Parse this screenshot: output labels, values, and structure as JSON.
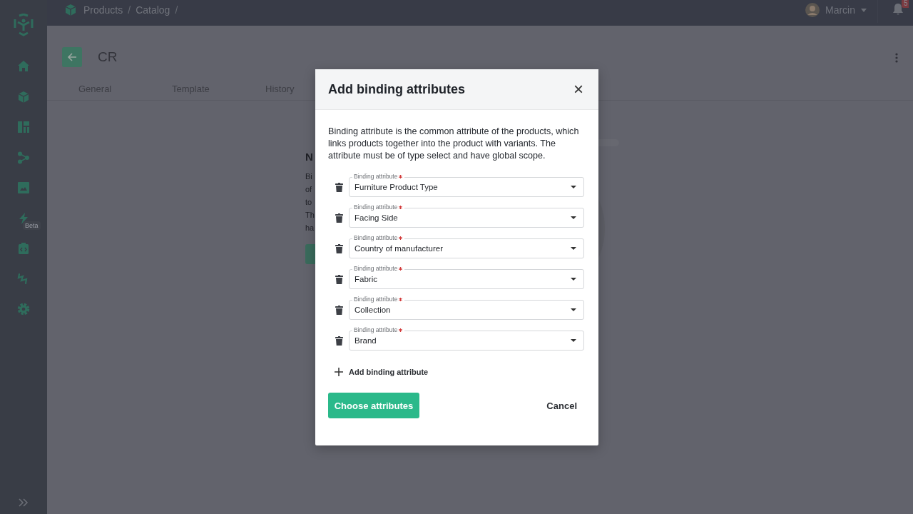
{
  "topbar": {
    "breadcrumbs": [
      "Products",
      "/",
      "Catalog",
      "/"
    ],
    "user": "Marcin",
    "notification_count": "5"
  },
  "sidebar": {
    "badge": "Beta"
  },
  "page": {
    "title": "CR",
    "tabs": [
      {
        "label": "General",
        "selected": false
      },
      {
        "label": "Template",
        "selected": false
      },
      {
        "label": "History",
        "selected": false
      }
    ]
  },
  "empty_state": {
    "heading": "N",
    "lines": [
      "Bi",
      "of",
      "to",
      "Th",
      "ha"
    ]
  },
  "dialog": {
    "title": "Add binding attributes",
    "close": "×",
    "description": "Binding attribute is the common attribute of the products, which links products together into the product with variants. The attribute must be of type select and have global scope.",
    "fields": [
      {
        "label": "Binding attribute",
        "required": true,
        "value": "Furniture Product Type"
      },
      {
        "label": "Binding attribute",
        "required": true,
        "value": "Facing Side"
      },
      {
        "label": "Binding attribute",
        "required": true,
        "value": "Country of manufacturer"
      },
      {
        "label": "Binding attribute",
        "required": true,
        "value": "Fabric"
      },
      {
        "label": "Binding attribute",
        "required": true,
        "value": "Collection"
      },
      {
        "label": "Binding attribute",
        "required": true,
        "value": "Brand"
      }
    ],
    "add_label": "Add binding attribute",
    "primary_button": "Choose attributes",
    "cancel_button": "Cancel"
  }
}
